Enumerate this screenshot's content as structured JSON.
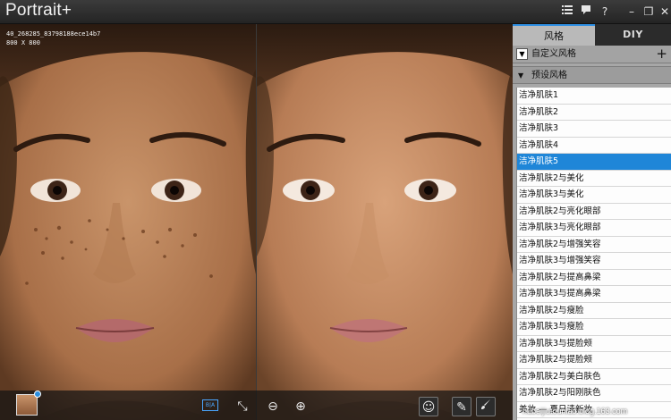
{
  "app": {
    "title": "Portrait+"
  },
  "titlebar": {
    "menu_icon": "list-menu-icon",
    "chat_icon": "chat-icon",
    "help_label": "?",
    "minimize_label": "–",
    "restore_label": "❐",
    "close_label": "✕"
  },
  "photo": {
    "filename": "40_268285_83798188ece14b7",
    "dimensions": "800 X 800"
  },
  "toolbar": {
    "thumbnail": "photo-thumbnail",
    "before_after_label": "B|A",
    "fit_label": "⤡",
    "zoom_out_label": "⊖",
    "zoom_in_label": "⊕",
    "smile_label": "☺",
    "eraser_label": "✎",
    "brush_label": "🖌"
  },
  "panel": {
    "tabs": [
      {
        "label": "风格",
        "active": true
      },
      {
        "label": "DIY",
        "active": false
      }
    ],
    "custom_section": {
      "toggle": "▼",
      "label": "自定义风格",
      "add_label": "+"
    },
    "preset_section": {
      "toggle": "▼",
      "label": "预设风格"
    },
    "presets": [
      "洁净肌肤1",
      "洁净肌肤2",
      "洁净肌肤3",
      "洁净肌肤4",
      "洁净肌肤5",
      "洁净肌肤2与美化",
      "洁净肌肤3与美化",
      "洁净肌肤2与亮化眼部",
      "洁净肌肤3与亮化眼部",
      "洁净肌肤2与增强笑容",
      "洁净肌肤3与增强笑容",
      "洁净肌肤2与提高鼻梁",
      "洁净肌肤3与提高鼻梁",
      "洁净肌肤2与瘦脸",
      "洁净肌肤3与瘦脸",
      "洁净肌肤3与提脸颊",
      "洁净肌肤2与提脸颊",
      "洁净肌肤2与美白肤色",
      "洁净肌肤2与阳刚肤色",
      "美妆 — 夏日清新妆"
    ],
    "selected_index": 4
  },
  "watermark": "hubeijiutouniao.blog.163.com",
  "colors": {
    "accent": "#1f86d8",
    "panel_bg": "#a7a7a7",
    "titlebar_bg": "#2a2a2a"
  }
}
